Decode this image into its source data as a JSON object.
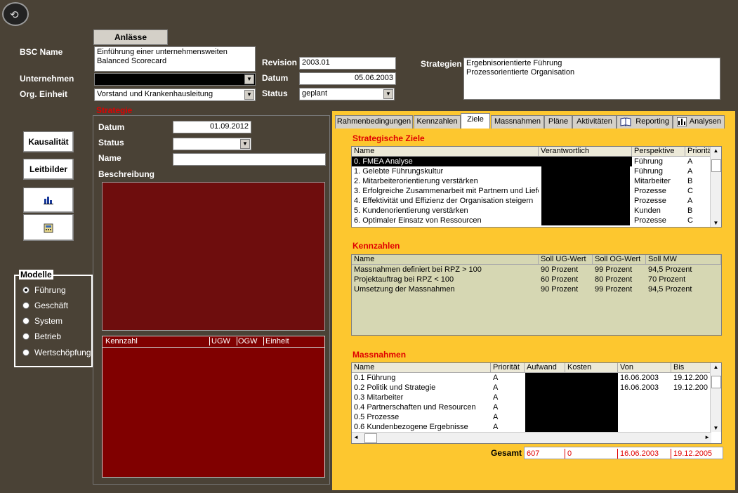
{
  "top": {
    "anlaesse_tab": "Anlässe",
    "bsc_name_label": "BSC Name",
    "bsc_name_value_1": "Einführung einer unternehmensweiten",
    "bsc_name_value_2": "Balanced Scorecard",
    "unternehmen_label": "Unternehmen",
    "org_einheit_label": "Org. Einheit",
    "org_einheit_value": "Vorstand und Krankenhausleitung",
    "revision_label": "Revision",
    "revision_value": "2003.01",
    "datum_label": "Datum",
    "datum_value": "05.06.2003",
    "status_label": "Status",
    "status_value": "geplant",
    "strategien_label": "Strategien",
    "strategien_1": "Ergebnisorientierte Führung",
    "strategien_2": "Prozessorientierte Organisation"
  },
  "left": {
    "kausalitaet": "Kausalität",
    "leitbilder": "Leitbilder",
    "modelle_title": "Modelle",
    "modelle": [
      "Führung",
      "Geschäft",
      "System",
      "Betrieb",
      "Wertschöpfung"
    ]
  },
  "strategie": {
    "title": "Strategie",
    "datum_label": "Datum",
    "datum_value": "01.09.2012",
    "status_label": "Status",
    "name_label": "Name",
    "beschreibung_label": "Beschreibung",
    "kennzahl_headers": [
      "Kennzahl",
      "UGW",
      "OGW",
      "Einheit"
    ]
  },
  "tabs": [
    "Rahmenbedingungen",
    "Kennzahlen",
    "Ziele",
    "Massnahmen",
    "Pläne",
    "Aktivitäten",
    "Reporting",
    "Analysen"
  ],
  "ziele": {
    "title": "Strategische Ziele",
    "headers": [
      "Name",
      "Verantwortlich",
      "Perspektive",
      "Priorität"
    ],
    "rows": [
      [
        "0. FMEA Analyse",
        "Führung",
        "A"
      ],
      [
        "1. Gelebte Führungskultur",
        "Führung",
        "A"
      ],
      [
        "2. Mitarbeiterorientierung verstärken",
        "Mitarbeiter",
        "B"
      ],
      [
        "3. Erfolgreiche Zusammenarbeit mit Partnern und Liefe",
        "Prozesse",
        "C"
      ],
      [
        "4. Effektivität und Effizienz der Organisation steigern",
        "Prozesse",
        "A"
      ],
      [
        "5. Kundenorientierung verstärken",
        "Kunden",
        "B"
      ],
      [
        "6. Optimaler Einsatz von Ressourcen",
        "Prozesse",
        "C"
      ]
    ]
  },
  "kennzahlen": {
    "title": "Kennzahlen",
    "headers": [
      "Name",
      "Soll UG-Wert",
      "Soll OG-Wert",
      "Soll MW"
    ],
    "rows": [
      [
        "Massnahmen definiert bei RPZ > 100",
        "90 Prozent",
        "99 Prozent",
        "94,5 Prozent"
      ],
      [
        "Projektauftrag bei RPZ < 100",
        "60 Prozent",
        "80 Prozent",
        "70 Prozent"
      ],
      [
        "Umsetzung der Massnahmen",
        "90 Prozent",
        "99 Prozent",
        "94,5 Prozent"
      ]
    ]
  },
  "massnahmen": {
    "title": "Massnahmen",
    "headers": [
      "Name",
      "Priorität",
      "Aufwand",
      "Kosten",
      "Von",
      "Bis"
    ],
    "rows": [
      [
        "0.1 Führung",
        "A",
        "16.06.2003",
        "19.12.200"
      ],
      [
        "0.2 Politik und Strategie",
        "A",
        "16.06.2003",
        "19.12.200"
      ],
      [
        "0.3 Mitarbeiter",
        "A",
        "",
        ""
      ],
      [
        "0.4 Partnerschaften und Resourcen",
        "A",
        "",
        ""
      ],
      [
        "0.5 Prozesse",
        "A",
        "",
        ""
      ],
      [
        "0.6 Kundenbezogene Ergebnisse",
        "A",
        "",
        ""
      ]
    ]
  },
  "gesamt": {
    "label": "Gesamt",
    "aufwand": "607",
    "kosten": "0",
    "von": "16.06.2003",
    "bis": "19.12.2005"
  },
  "colors": {
    "background": "#4a4236",
    "panel": "#fdc72f",
    "accent_red": "#e00000",
    "strategie_dark_red": "#6e0d0d",
    "kennzahl_red": "#800000"
  }
}
